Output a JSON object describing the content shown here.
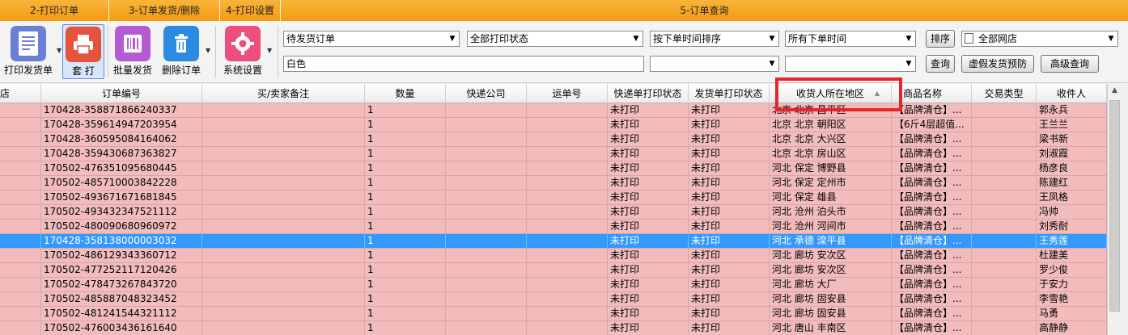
{
  "sections": [
    {
      "label": "2-打印订单"
    },
    {
      "label": "3-订单发货/删除"
    },
    {
      "label": "4-打印设置"
    },
    {
      "label": "5-订单查询"
    }
  ],
  "toolbar": {
    "print_invoice": "打印发货单",
    "set_print": "套 打",
    "batch_ship": "批量发货",
    "delete_order": "删除订单",
    "settings": "系统设置"
  },
  "filters": {
    "order_status": "待发货订单",
    "print_status": "全部打印状态",
    "sort_by": "按下单时间排序",
    "time_range": "所有下单时间",
    "sort_button": "排序",
    "store": "全部网店",
    "keyword": "白色",
    "combo5": "",
    "combo6": "",
    "query_button": "查询",
    "fake_ship_button": "虚假发货预防",
    "advanced_button": "高级查询"
  },
  "colors": {
    "section_bar": "#f5a623",
    "row_bg": "#f2bcbc",
    "selected_row": "#3399ff",
    "highlight": "#e8242b"
  },
  "grid": {
    "headers": [
      "店",
      "订单编号",
      "买/卖家备注",
      "数量",
      "快递公司",
      "运单号",
      "快递单打印状态",
      "发货单打印状态",
      "收货人所在地区",
      "商品名称",
      "交易类型",
      "收件人"
    ],
    "rows": [
      [
        "",
        "170428-358871866240337",
        "",
        "1",
        "",
        "",
        "未打印",
        "未打印",
        "北京 北京 昌平区",
        "【品牌清仓】...",
        "",
        "郭永兵"
      ],
      [
        "",
        "170428-359614947203954",
        "",
        "1",
        "",
        "",
        "未打印",
        "未打印",
        "北京 北京 朝阳区",
        "【6斤4层超值...",
        "",
        "王兰兰"
      ],
      [
        "",
        "170428-360595084164062",
        "",
        "1",
        "",
        "",
        "未打印",
        "未打印",
        "北京 北京 大兴区",
        "【品牌清仓】...",
        "",
        "梁书新"
      ],
      [
        "",
        "170428-359430687363827",
        "",
        "1",
        "",
        "",
        "未打印",
        "未打印",
        "北京 北京 房山区",
        "【品牌清仓】...",
        "",
        "刘淑霞"
      ],
      [
        "",
        "170502-476351095680445",
        "",
        "1",
        "",
        "",
        "未打印",
        "未打印",
        "河北 保定 博野县",
        "【品牌清仓】...",
        "",
        "杨彦良"
      ],
      [
        "",
        "170502-485710003842228",
        "",
        "1",
        "",
        "",
        "未打印",
        "未打印",
        "河北 保定 定州市",
        "【品牌清仓】...",
        "",
        "陈建红"
      ],
      [
        "",
        "170502-493671671681845",
        "",
        "1",
        "",
        "",
        "未打印",
        "未打印",
        "河北 保定 雄县",
        "【品牌清仓】...",
        "",
        "王凤格"
      ],
      [
        "",
        "170502-493432347521112",
        "",
        "1",
        "",
        "",
        "未打印",
        "未打印",
        "河北 沧州 泊头市",
        "【品牌清仓】...",
        "",
        "冯帅"
      ],
      [
        "",
        "170502-480090680960972",
        "",
        "1",
        "",
        "",
        "未打印",
        "未打印",
        "河北 沧州 河间市",
        "【品牌清仓】...",
        "",
        "刘秀耐"
      ],
      [
        "",
        "170428-358138000003032",
        "",
        "1",
        "",
        "",
        "未打印",
        "未打印",
        "河北 承德 滦平县",
        "【品牌清仓】...",
        "",
        "王秀莲"
      ],
      [
        "",
        "170502-486129343360712",
        "",
        "1",
        "",
        "",
        "未打印",
        "未打印",
        "河北 廊坊 安次区",
        "【品牌清仓】...",
        "",
        "杜建美"
      ],
      [
        "",
        "170502-477252117120426",
        "",
        "1",
        "",
        "",
        "未打印",
        "未打印",
        "河北 廊坊 安次区",
        "【品牌清仓】...",
        "",
        "罗少俊"
      ],
      [
        "",
        "170502-478473267843720",
        "",
        "1",
        "",
        "",
        "未打印",
        "未打印",
        "河北 廊坊 大厂",
        "【品牌清仓】...",
        "",
        "于安力"
      ],
      [
        "",
        "170502-485887048323452",
        "",
        "1",
        "",
        "",
        "未打印",
        "未打印",
        "河北 廊坊 固安县",
        "【品牌清仓】...",
        "",
        "李雪艳"
      ],
      [
        "",
        "170502-481241544321112",
        "",
        "1",
        "",
        "",
        "未打印",
        "未打印",
        "河北 廊坊 固安县",
        "【品牌清仓】...",
        "",
        "马勇"
      ],
      [
        "",
        "170502-476003436161640",
        "",
        "1",
        "",
        "",
        "未打印",
        "未打印",
        "河北 唐山 丰南区",
        "【品牌清仓】...",
        "",
        "高静静"
      ]
    ],
    "selected_row_index": 9
  }
}
